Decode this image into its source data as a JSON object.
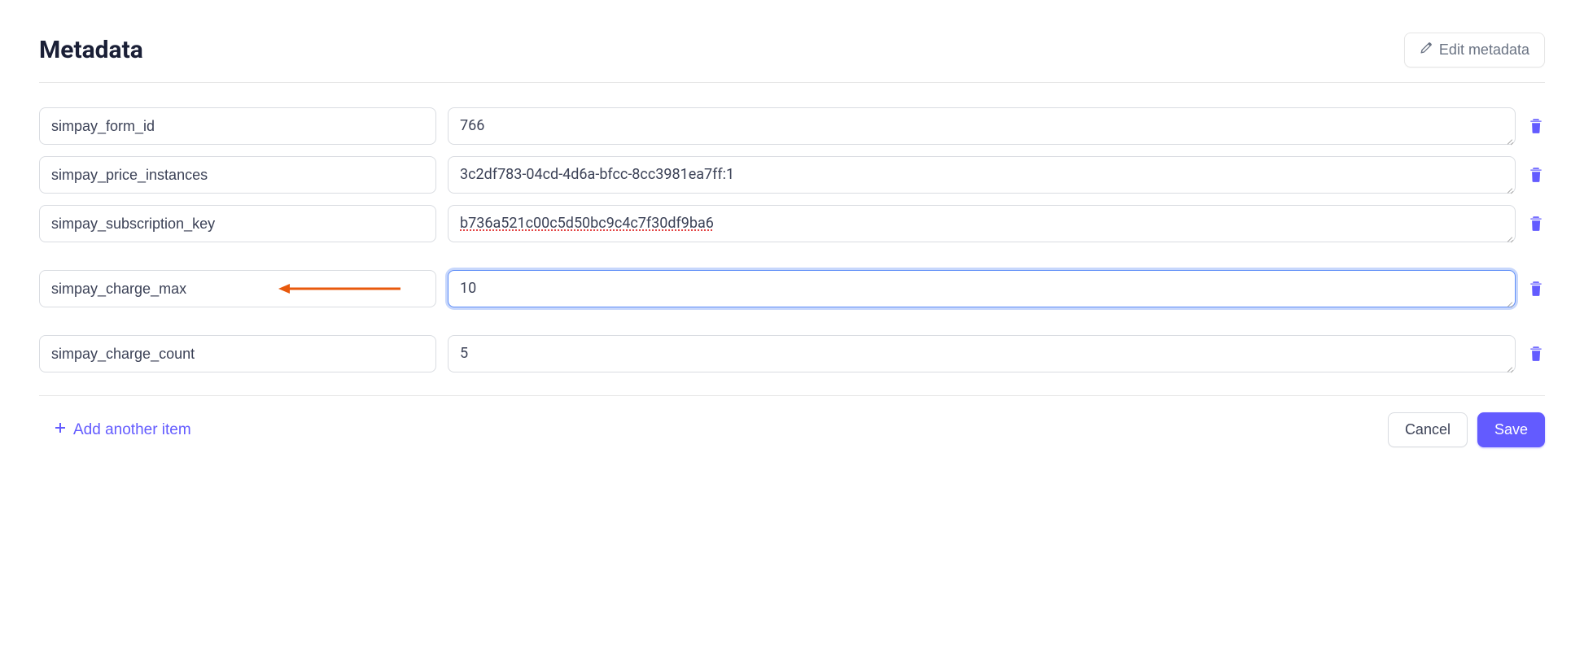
{
  "header": {
    "title": "Metadata",
    "edit_label": "Edit metadata"
  },
  "rows": [
    {
      "key": "simpay_form_id",
      "value": "766",
      "highlighted": false,
      "focused": false,
      "spellcheck": false
    },
    {
      "key": "simpay_price_instances",
      "value": "3c2df783-04cd-4d6a-bfcc-8cc3981ea7ff:1",
      "highlighted": false,
      "focused": false,
      "spellcheck": false
    },
    {
      "key": "simpay_subscription_key",
      "value": "b736a521c00c5d50bc9c4c7f30df9ba6",
      "highlighted": false,
      "focused": false,
      "spellcheck": true
    },
    {
      "key": "simpay_charge_max",
      "value": "10",
      "highlighted": true,
      "focused": true,
      "spellcheck": false
    },
    {
      "key": "simpay_charge_count",
      "value": "5",
      "highlighted": false,
      "focused": false,
      "spellcheck": false
    }
  ],
  "footer": {
    "add_label": "Add another item",
    "cancel_label": "Cancel",
    "save_label": "Save"
  }
}
